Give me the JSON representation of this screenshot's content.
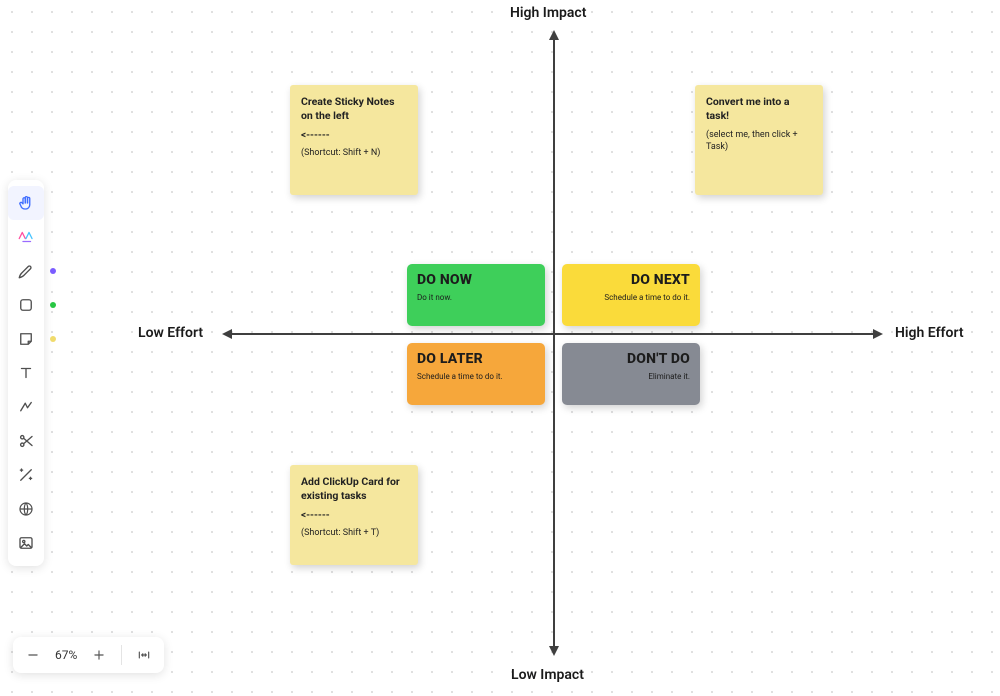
{
  "axes": {
    "top": "High Impact",
    "bottom": "Low Impact",
    "left": "Low Effort",
    "right": "High Effort"
  },
  "quadrants": {
    "do_now": {
      "title": "DO NOW",
      "sub": "Do it now."
    },
    "do_next": {
      "title": "DO NEXT",
      "sub": "Schedule a time to do it."
    },
    "do_later": {
      "title": "DO LATER",
      "sub": "Schedule a time to do it."
    },
    "dont_do": {
      "title": "DON'T DO",
      "sub": "Eliminate it."
    }
  },
  "stickies": {
    "s1": {
      "title": "Create Sticky Notes on the left",
      "arrow": "<------",
      "hint": "(Shortcut: Shift + N)"
    },
    "s2": {
      "title": "Convert me into a task!",
      "hint": "(select me, then click + Task)"
    },
    "s3": {
      "title": "Add ClickUp Card for existing tasks",
      "arrow": "<------",
      "hint": "(Shortcut: Shift + T)"
    }
  },
  "zoom": {
    "value": "67%"
  },
  "toolbar_dots": {
    "pen": "#7a5cff",
    "shape": "#28c643",
    "note": "#f0db6c"
  }
}
